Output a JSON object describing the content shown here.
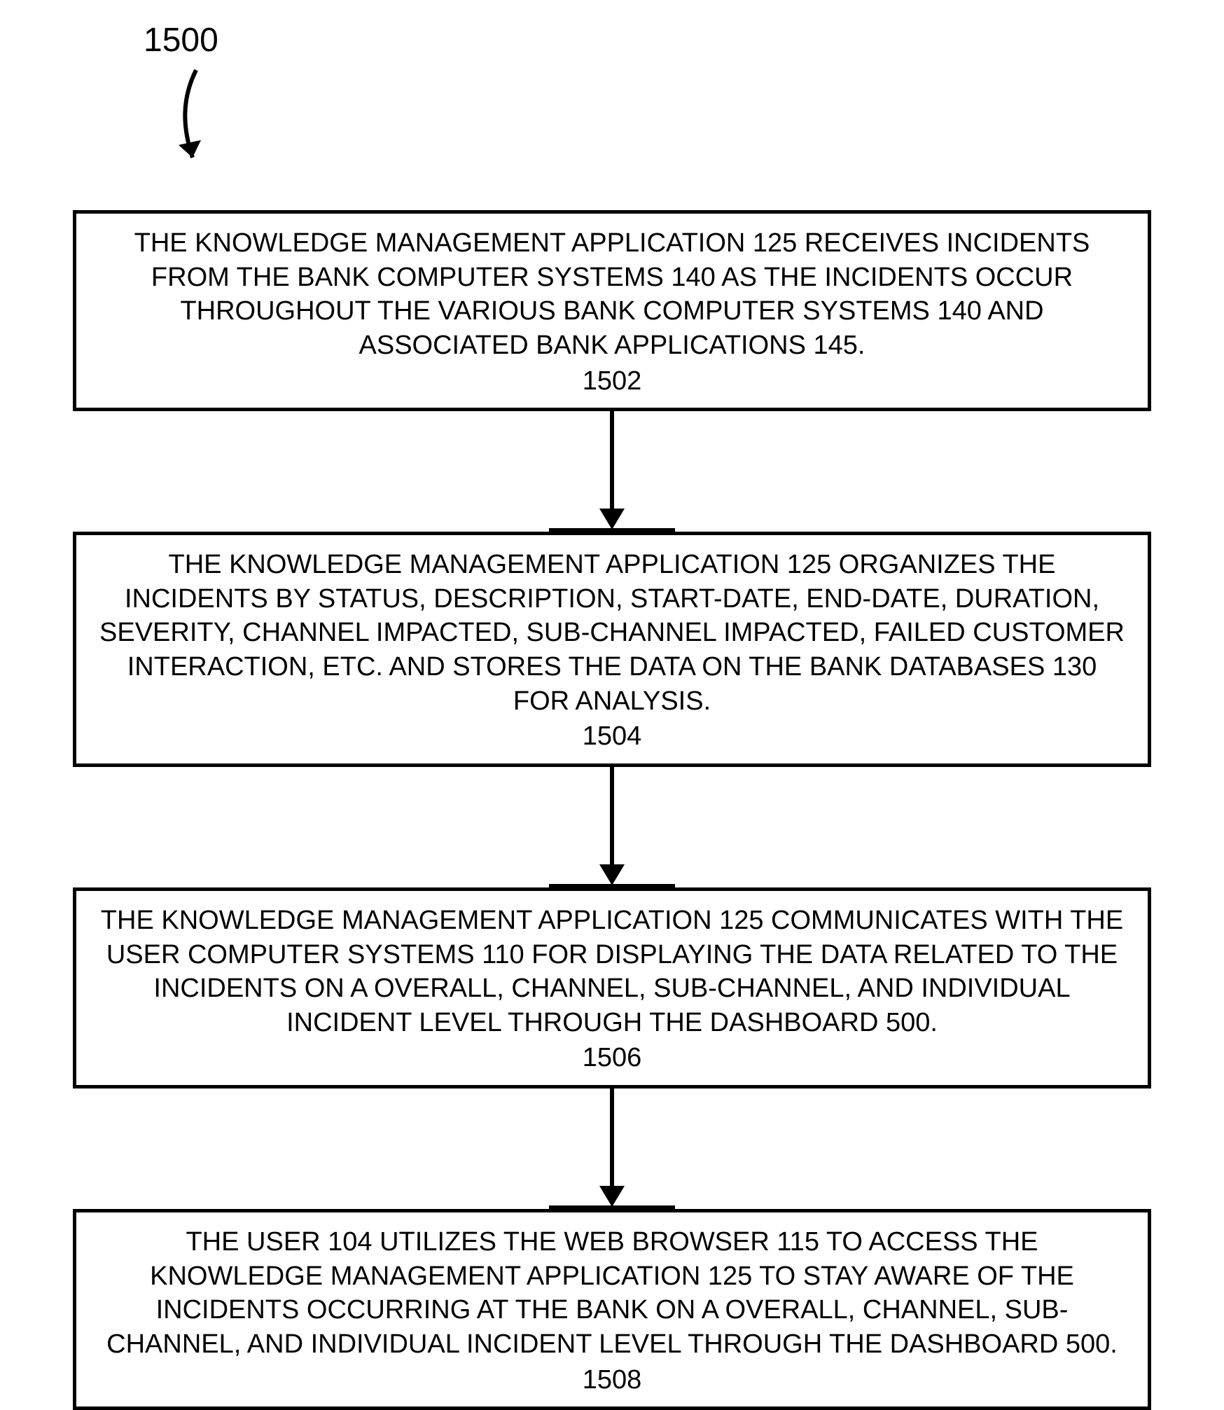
{
  "figure_label": "1500",
  "steps": [
    {
      "text": "THE KNOWLEDGE MANAGEMENT APPLICATION 125 RECEIVES INCIDENTS FROM THE BANK COMPUTER SYSTEMS 140 AS THE INCIDENTS OCCUR THROUGHOUT THE VARIOUS BANK COMPUTER SYSTEMS 140 AND ASSOCIATED BANK APPLICATIONS 145.",
      "ref": "1502"
    },
    {
      "text": "THE KNOWLEDGE MANAGEMENT APPLICATION 125 ORGANIZES THE INCIDENTS BY STATUS, DESCRIPTION, START-DATE, END-DATE, DURATION, SEVERITY, CHANNEL IMPACTED, SUB-CHANNEL IMPACTED, FAILED CUSTOMER INTERACTION, ETC. AND STORES THE DATA ON THE BANK DATABASES 130 FOR ANALYSIS.",
      "ref": "1504"
    },
    {
      "text": "THE KNOWLEDGE MANAGEMENT APPLICATION 125 COMMUNICATES WITH THE USER COMPUTER SYSTEMS 110 FOR DISPLAYING THE DATA RELATED TO THE INCIDENTS ON A OVERALL, CHANNEL, SUB-CHANNEL, AND INDIVIDUAL INCIDENT LEVEL THROUGH THE DASHBOARD 500.",
      "ref": "1506"
    },
    {
      "text": "THE USER 104 UTILIZES THE WEB BROWSER 115 TO ACCESS THE KNOWLEDGE MANAGEMENT APPLICATION 125 TO STAY AWARE OF THE INCIDENTS OCCURRING AT THE BANK ON A OVERALL, CHANNEL, SUB-CHANNEL, AND INDIVIDUAL INCIDENT LEVEL THROUGH THE DASHBOARD 500.",
      "ref": "1508"
    }
  ]
}
